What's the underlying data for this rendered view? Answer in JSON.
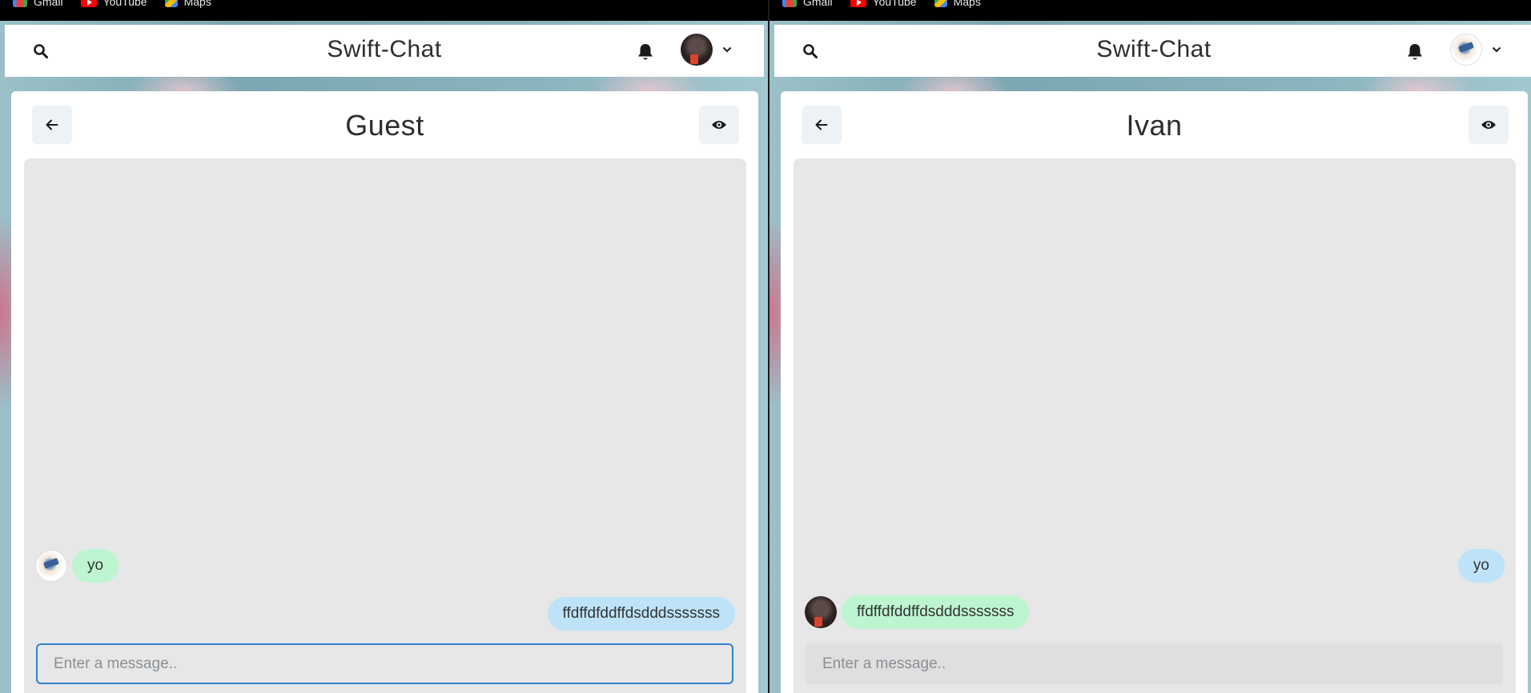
{
  "bookmarks": [
    {
      "label": "Gmail",
      "icon": "gmail-icon"
    },
    {
      "label": "YouTube",
      "icon": "youtube-icon"
    },
    {
      "label": "Maps",
      "icon": "maps-icon"
    }
  ],
  "panes": [
    {
      "app_title": "Swift-Chat",
      "chat_title": "Guest",
      "messages": [
        {
          "text": "yo",
          "from": "other",
          "color": "#bdf5d0",
          "avatar": "light"
        },
        {
          "text": "ffdffdfddffdsdddsssssss",
          "from": "me",
          "color": "#bee3f8"
        }
      ],
      "input_placeholder": "Enter a message..",
      "input_value": ""
    },
    {
      "app_title": "Swift-Chat",
      "chat_title": "Ivan",
      "messages": [
        {
          "text": "yo",
          "from": "me",
          "color": "#bee3f8"
        },
        {
          "text": "ffdffdfddffdsdddsssssss",
          "from": "other",
          "color": "#bdf5d0",
          "avatar": "dark"
        }
      ],
      "input_placeholder": "Enter a message..",
      "input_value": ""
    }
  ],
  "colors": {
    "accent_focus": "#3182ce",
    "bubble_incoming": "#bdf5d0",
    "bubble_outgoing": "#bee3f8",
    "chat_background": "#e7e7e7",
    "icon_button_bg": "#edf2f7"
  }
}
